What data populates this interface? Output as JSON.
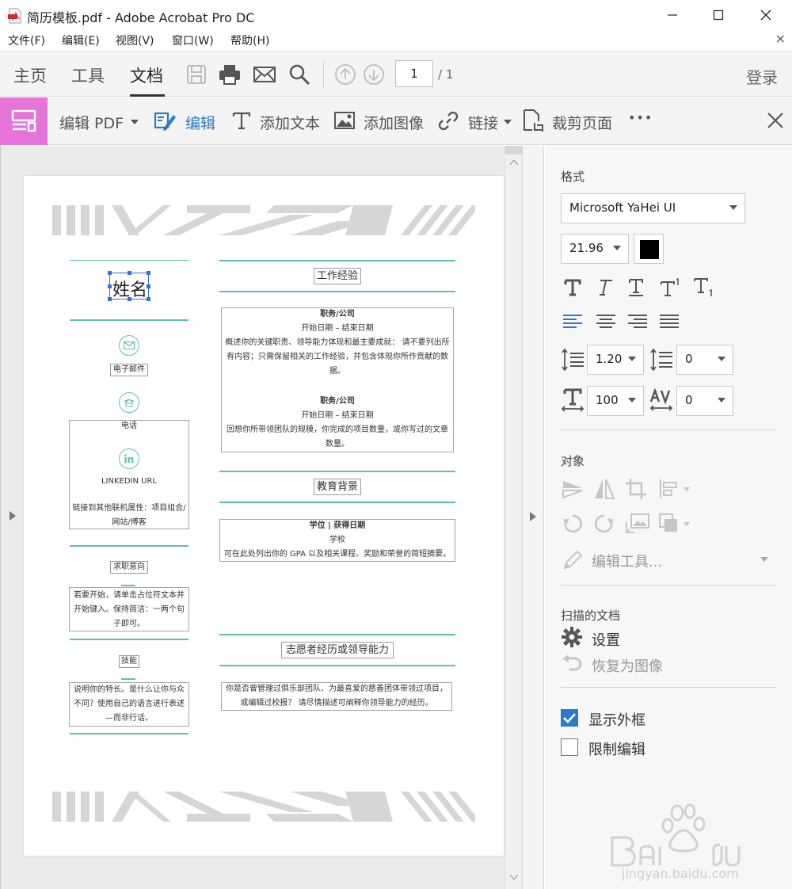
{
  "window": {
    "title": "简历模板.pdf - Adobe Acrobat Pro DC"
  },
  "menu": {
    "file": "文件(F)",
    "edit": "编辑(E)",
    "view": "视图(V)",
    "window": "窗口(W)",
    "help": "帮助(H)",
    "close_doc": "×"
  },
  "nav": {
    "home": "主页",
    "tools": "工具",
    "document": "文档",
    "page_current": "1",
    "page_total": "/ 1",
    "login": "登录"
  },
  "edit_toolbar": {
    "edit_pdf": "编辑 PDF",
    "edit": "编辑",
    "add_text": "添加文本",
    "add_image": "添加图像",
    "link": "链接",
    "crop": "裁剪页面",
    "more": "•••"
  },
  "document": {
    "name": "姓名",
    "email": "电子邮件",
    "phone": "电话",
    "linkedin": "LINKEDIN URL",
    "link_other_1": "链接到其他联机属性：项目组合/",
    "link_other_2": "网站/博客",
    "objective_title": "求职意向",
    "objective_1": "若要开始，请单击占位符文本并",
    "objective_2": "开始键入。保持简洁：一两个句",
    "objective_3": "子即可。",
    "skills_title": "技能",
    "skills_1": "说明你的特长。是什么让你与众",
    "skills_2": "不同？使用自己的语言进行表述",
    "skills_3": "—而非行话。",
    "work_title": "工作经验",
    "job1_title": "职务/公司",
    "job1_dates": "开始日期 – 结束日期",
    "job1_desc_1": "概述你的关键职责、领导能力体现和最主要成就： 请不要列出所",
    "job1_desc_2": "有内容；只需保留相关的工作经验，并包含体现你所作贡献的数",
    "job1_desc_3": "据。",
    "job2_title": "职务/公司",
    "job2_dates": "开始日期 – 结束日期",
    "job2_desc_1": "回想你所带领团队的规模，你完成的项目数量，或你写过的文章",
    "job2_desc_2": "数量。",
    "edu_title": "教育背景",
    "edu_degree": "学位 | 获得日期",
    "edu_school": "学校",
    "edu_desc": "可在此处列出你的 GPA 以及相关课程、奖励和荣誉的简短摘要。",
    "vol_title": "志愿者经历或领导能力",
    "vol_desc_1": "你是否曾管理过俱乐部团队、为最喜爱的慈善团体带领过项目，",
    "vol_desc_2": "或编辑过校报？ 请尽情描述可阐释你领导能力的经历。"
  },
  "panel": {
    "format_title": "格式",
    "font_name": "Microsoft YaHei UI",
    "font_size": "21.96",
    "text_color": "#000000",
    "line_spacing": "1.20",
    "para_spacing": "0",
    "horiz_scale": "100",
    "char_spacing": "0",
    "objects_title": "对象",
    "edit_tool": "编辑工具...",
    "scanned_title": "扫描的文档",
    "settings": "设置",
    "revert_image": "恢复为图像",
    "show_bbox": "显示外框",
    "restrict_edit": "限制编辑"
  },
  "colors": {
    "accent_blue": "#2a7ac8",
    "tool_badge": "#e674d9",
    "teal": "#5dc0b4"
  }
}
